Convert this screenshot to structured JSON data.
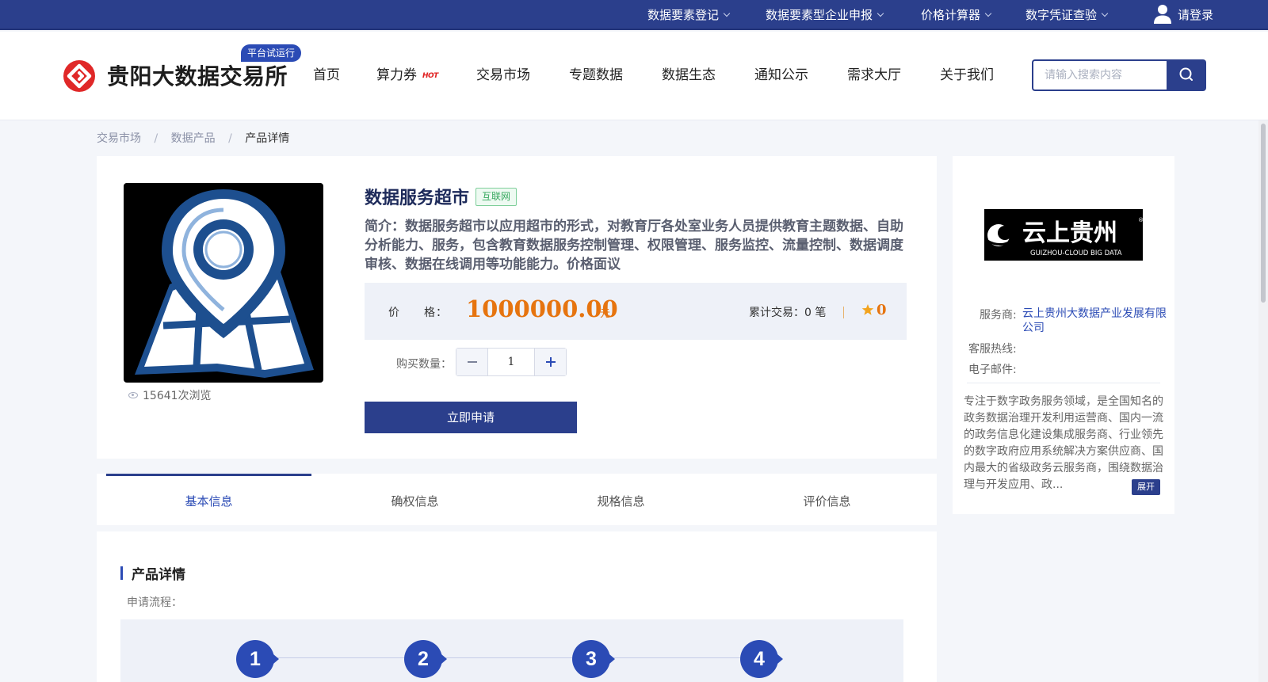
{
  "topbar": {
    "items": [
      {
        "label": "数据要素登记"
      },
      {
        "label": "数据要素型企业申报"
      },
      {
        "label": "价格计算器"
      },
      {
        "label": "数字凭证查验"
      }
    ],
    "login": "请登录"
  },
  "header": {
    "logo_text": "贵阳大数据交易所",
    "trial_badge": "平台试运行",
    "nav": [
      "首页",
      "算力券",
      "交易市场",
      "专题数据",
      "数据生态",
      "通知公示",
      "需求大厅",
      "关于我们"
    ],
    "hot_badge": "HOT",
    "search_placeholder": "请输入搜索内容"
  },
  "breadcrumb": [
    "交易市场",
    "数据产品",
    "产品详情"
  ],
  "breadcrumb_sep": "/",
  "product": {
    "title": "数据服务超市",
    "tag": "互联网",
    "description": "简介：数据服务超市以应用超市的形式，对教育厅各处室业务人员提供教育主题数据、自助分析能力、服务，包含教育数据服务控制管理、权限管理、服务监控、流量控制、数据调度审核、数据在线调用等功能能力。价格面议",
    "views": "15641次浏览",
    "price_label": "价　　格：",
    "price": "1000000.00",
    "price_unit": "元",
    "deals": "累计交易：0 笔",
    "rating": "0",
    "qty_label": "购买数量：",
    "qty": "1",
    "apply": "立即申请"
  },
  "tabs": [
    "基本信息",
    "确权信息",
    "规格信息",
    "评价信息"
  ],
  "detail": {
    "title": "产品详情",
    "flow_label": "申请流程：",
    "steps": [
      "1",
      "2",
      "3",
      "4"
    ]
  },
  "vendor": {
    "logo_cn": "云上贵州",
    "logo_en": "GUIZHOU-CLOUD BIG DATA",
    "provider_label": "服务商:",
    "provider": "云上贵州大数据产业发展有限公司",
    "hotline_label": "客服热线:",
    "email_label": "电子邮件:",
    "description": "专注于数字政务服务领域，是全国知名的政务数据治理开发利用运营商、国内一流的政务信息化建设集成服务商、行业领先的数字政府应用系统解决方案供应商、国内最大的省级政务云服务商，围绕数据治理与开发应用、政...",
    "expand": "展开"
  },
  "colors": {
    "primary": "#2b3f8c",
    "accent": "#2b4bb5",
    "price": "#e6740f",
    "tag_green": "#35a85d"
  }
}
